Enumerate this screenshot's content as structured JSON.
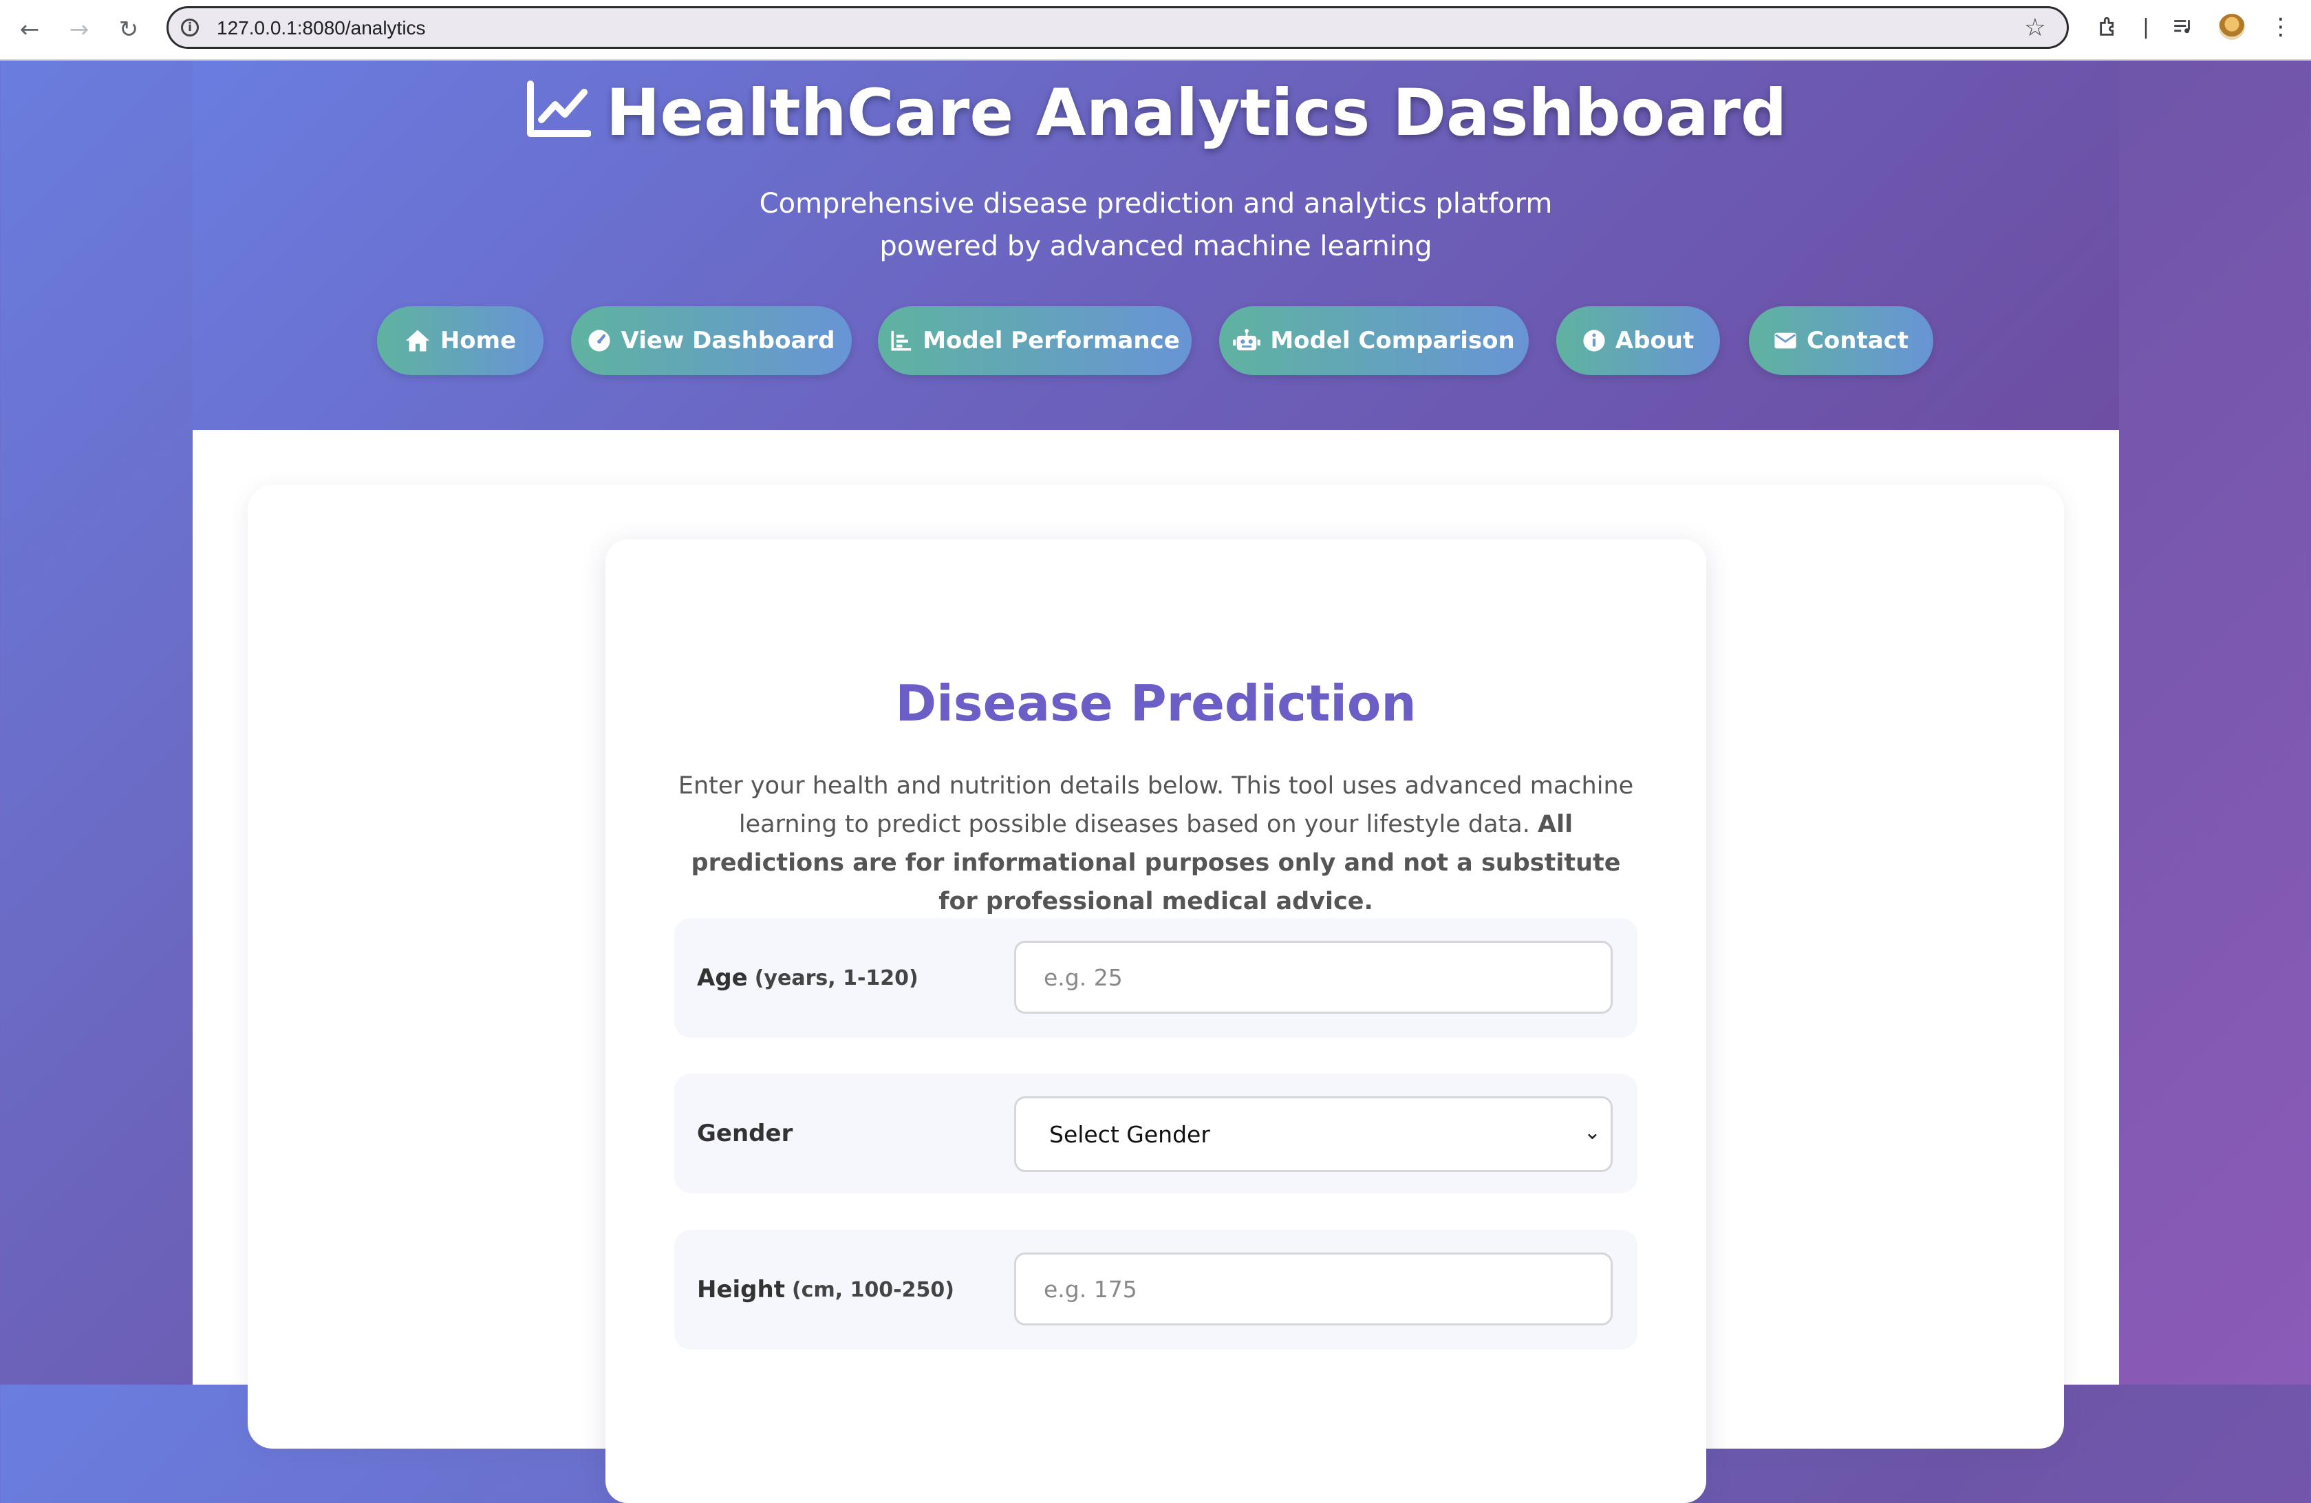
{
  "browser": {
    "url": "127.0.0.1:8080/analytics"
  },
  "header": {
    "title": "HealthCare Analytics Dashboard",
    "subtitle": "Comprehensive disease prediction and analytics platform powered by advanced machine learning",
    "nav": [
      {
        "label": "Home",
        "icon": "home-icon"
      },
      {
        "label": "View Dashboard",
        "icon": "gauge-icon"
      },
      {
        "label": "Model Performance",
        "icon": "bar-chart-icon"
      },
      {
        "label": "Model Comparison",
        "icon": "robot-icon"
      },
      {
        "label": "About",
        "icon": "info-icon"
      },
      {
        "label": "Contact",
        "icon": "envelope-icon"
      }
    ]
  },
  "form": {
    "title": "Disease Prediction",
    "intro": "Enter your health and nutrition details below. This tool uses advanced machine learning to predict possible diseases based on your lifestyle data.",
    "intro_bold": "All predictions are for informational purposes only and not a substitute for professional medical advice.",
    "fields": [
      {
        "label": "Age",
        "hint": "(years, 1-120)",
        "placeholder": "e.g. 25"
      },
      {
        "label": "Gender",
        "selected": "Select Gender"
      },
      {
        "label": "Height",
        "hint": "(cm, 100-250)",
        "placeholder": "e.g. 175"
      }
    ]
  },
  "colors": {
    "accent": "#6b5fc7",
    "pill_start": "#5fb3a0",
    "pill_end": "#6894d6"
  }
}
